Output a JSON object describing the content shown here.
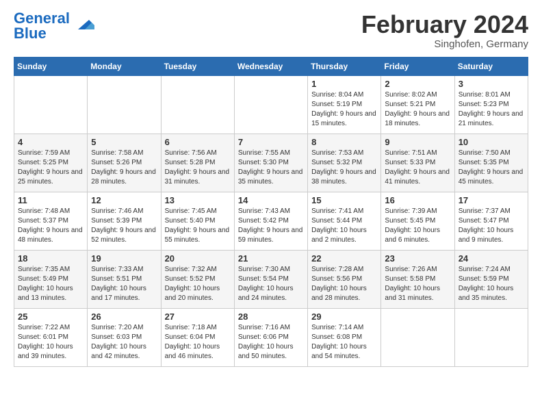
{
  "header": {
    "logo_text1": "General",
    "logo_text2": "Blue",
    "month": "February 2024",
    "location": "Singhofen, Germany"
  },
  "days_of_week": [
    "Sunday",
    "Monday",
    "Tuesday",
    "Wednesday",
    "Thursday",
    "Friday",
    "Saturday"
  ],
  "weeks": [
    [
      {
        "day": "",
        "info": ""
      },
      {
        "day": "",
        "info": ""
      },
      {
        "day": "",
        "info": ""
      },
      {
        "day": "",
        "info": ""
      },
      {
        "day": "1",
        "info": "Sunrise: 8:04 AM\nSunset: 5:19 PM\nDaylight: 9 hours\nand 15 minutes."
      },
      {
        "day": "2",
        "info": "Sunrise: 8:02 AM\nSunset: 5:21 PM\nDaylight: 9 hours\nand 18 minutes."
      },
      {
        "day": "3",
        "info": "Sunrise: 8:01 AM\nSunset: 5:23 PM\nDaylight: 9 hours\nand 21 minutes."
      }
    ],
    [
      {
        "day": "4",
        "info": "Sunrise: 7:59 AM\nSunset: 5:25 PM\nDaylight: 9 hours\nand 25 minutes."
      },
      {
        "day": "5",
        "info": "Sunrise: 7:58 AM\nSunset: 5:26 PM\nDaylight: 9 hours\nand 28 minutes."
      },
      {
        "day": "6",
        "info": "Sunrise: 7:56 AM\nSunset: 5:28 PM\nDaylight: 9 hours\nand 31 minutes."
      },
      {
        "day": "7",
        "info": "Sunrise: 7:55 AM\nSunset: 5:30 PM\nDaylight: 9 hours\nand 35 minutes."
      },
      {
        "day": "8",
        "info": "Sunrise: 7:53 AM\nSunset: 5:32 PM\nDaylight: 9 hours\nand 38 minutes."
      },
      {
        "day": "9",
        "info": "Sunrise: 7:51 AM\nSunset: 5:33 PM\nDaylight: 9 hours\nand 41 minutes."
      },
      {
        "day": "10",
        "info": "Sunrise: 7:50 AM\nSunset: 5:35 PM\nDaylight: 9 hours\nand 45 minutes."
      }
    ],
    [
      {
        "day": "11",
        "info": "Sunrise: 7:48 AM\nSunset: 5:37 PM\nDaylight: 9 hours\nand 48 minutes."
      },
      {
        "day": "12",
        "info": "Sunrise: 7:46 AM\nSunset: 5:39 PM\nDaylight: 9 hours\nand 52 minutes."
      },
      {
        "day": "13",
        "info": "Sunrise: 7:45 AM\nSunset: 5:40 PM\nDaylight: 9 hours\nand 55 minutes."
      },
      {
        "day": "14",
        "info": "Sunrise: 7:43 AM\nSunset: 5:42 PM\nDaylight: 9 hours\nand 59 minutes."
      },
      {
        "day": "15",
        "info": "Sunrise: 7:41 AM\nSunset: 5:44 PM\nDaylight: 10 hours\nand 2 minutes."
      },
      {
        "day": "16",
        "info": "Sunrise: 7:39 AM\nSunset: 5:45 PM\nDaylight: 10 hours\nand 6 minutes."
      },
      {
        "day": "17",
        "info": "Sunrise: 7:37 AM\nSunset: 5:47 PM\nDaylight: 10 hours\nand 9 minutes."
      }
    ],
    [
      {
        "day": "18",
        "info": "Sunrise: 7:35 AM\nSunset: 5:49 PM\nDaylight: 10 hours\nand 13 minutes."
      },
      {
        "day": "19",
        "info": "Sunrise: 7:33 AM\nSunset: 5:51 PM\nDaylight: 10 hours\nand 17 minutes."
      },
      {
        "day": "20",
        "info": "Sunrise: 7:32 AM\nSunset: 5:52 PM\nDaylight: 10 hours\nand 20 minutes."
      },
      {
        "day": "21",
        "info": "Sunrise: 7:30 AM\nSunset: 5:54 PM\nDaylight: 10 hours\nand 24 minutes."
      },
      {
        "day": "22",
        "info": "Sunrise: 7:28 AM\nSunset: 5:56 PM\nDaylight: 10 hours\nand 28 minutes."
      },
      {
        "day": "23",
        "info": "Sunrise: 7:26 AM\nSunset: 5:58 PM\nDaylight: 10 hours\nand 31 minutes."
      },
      {
        "day": "24",
        "info": "Sunrise: 7:24 AM\nSunset: 5:59 PM\nDaylight: 10 hours\nand 35 minutes."
      }
    ],
    [
      {
        "day": "25",
        "info": "Sunrise: 7:22 AM\nSunset: 6:01 PM\nDaylight: 10 hours\nand 39 minutes."
      },
      {
        "day": "26",
        "info": "Sunrise: 7:20 AM\nSunset: 6:03 PM\nDaylight: 10 hours\nand 42 minutes."
      },
      {
        "day": "27",
        "info": "Sunrise: 7:18 AM\nSunset: 6:04 PM\nDaylight: 10 hours\nand 46 minutes."
      },
      {
        "day": "28",
        "info": "Sunrise: 7:16 AM\nSunset: 6:06 PM\nDaylight: 10 hours\nand 50 minutes."
      },
      {
        "day": "29",
        "info": "Sunrise: 7:14 AM\nSunset: 6:08 PM\nDaylight: 10 hours\nand 54 minutes."
      },
      {
        "day": "",
        "info": ""
      },
      {
        "day": "",
        "info": ""
      }
    ]
  ]
}
